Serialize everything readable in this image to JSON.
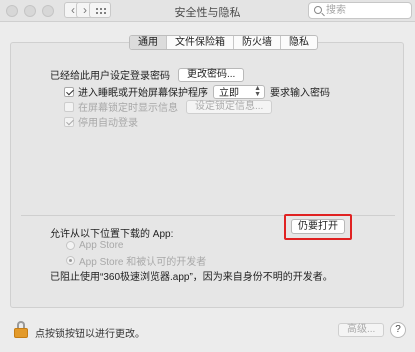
{
  "window": {
    "title": "安全性与隐私",
    "back": "‹",
    "forward": "›",
    "search_placeholder": "搜索"
  },
  "tabs": [
    {
      "label": "通用",
      "active": true
    },
    {
      "label": "文件保险箱",
      "active": false
    },
    {
      "label": "防火墙",
      "active": false
    },
    {
      "label": "隐私",
      "active": false
    }
  ],
  "general": {
    "password_label": "已经给此用户设定登录密码",
    "change_password_button": "更改密码...",
    "require_password": {
      "checked": true,
      "prefix": "进入睡眠或开始屏幕保护程序",
      "select_value": "立即",
      "suffix": "要求输入密码"
    },
    "show_message": {
      "checked": false,
      "label": "在屏幕锁定时显示信息",
      "button": "设定锁定信息..."
    },
    "disable_autologin": {
      "checked": true,
      "label": "停用自动登录"
    }
  },
  "downloads": {
    "heading": "允许从以下位置下载的 App:",
    "options": [
      {
        "label": "App Store",
        "selected": false
      },
      {
        "label": "App Store 和被认可的开发者",
        "selected": true
      }
    ],
    "blocked_message": "已阻止使用“360极速浏览器.app”，因为来自身份不明的开发者。",
    "open_anyway_button": "仍要打开"
  },
  "footer": {
    "lock_text": "点按锁按钮以进行更改。",
    "advanced_button": "高级...",
    "help": "?"
  },
  "colors": {
    "highlight": "#e02222",
    "lock": "#e39a2a"
  }
}
